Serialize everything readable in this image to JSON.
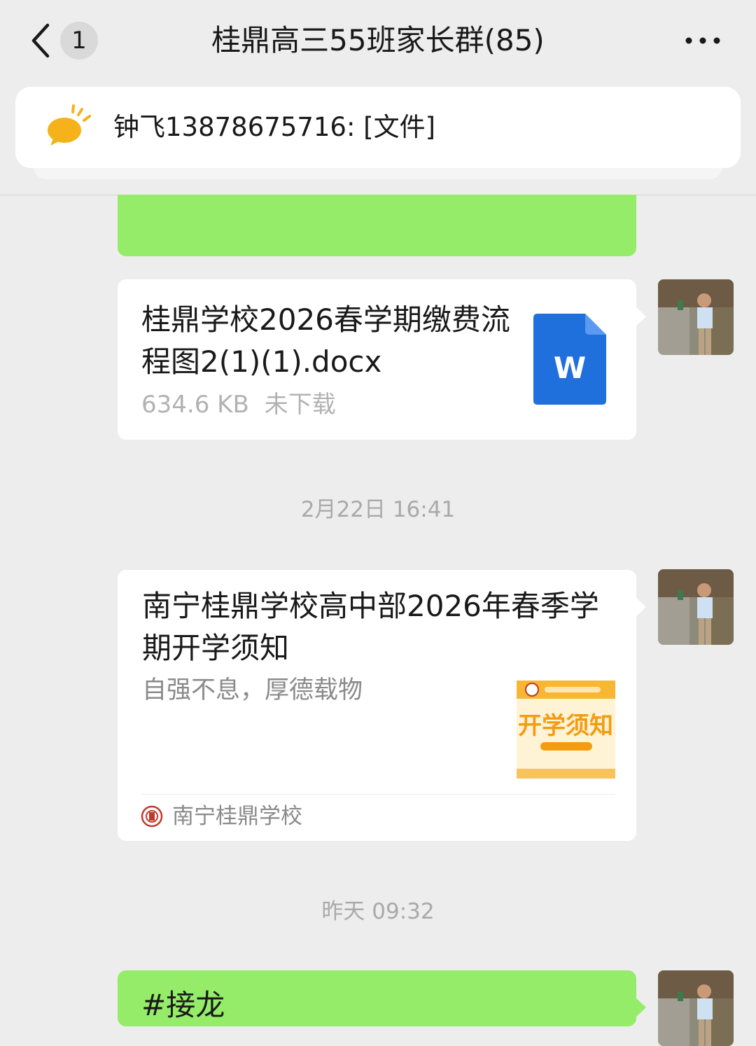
{
  "header": {
    "back_icon": "chevron-left-icon",
    "unread_count": "1",
    "title": "桂鼎高三55班家长群(85)",
    "more_icon": "ellipsis-icon"
  },
  "pinned": {
    "icon": "announcement-icon",
    "text": "钟飞13878675716: [文件]"
  },
  "messages": {
    "file": {
      "name": "桂鼎学校2026春学期缴费流程图2(1)(1).docx",
      "size": "634.6 KB",
      "status": "未下载",
      "icon_letter": "W"
    },
    "time1": "2月22日 16:41",
    "article": {
      "title": "南宁桂鼎学校高中部2026年春季学期开学须知",
      "description": "自强不息，厚德载物",
      "thumbnail_text": "开学须知",
      "source": "南宁桂鼎学校"
    },
    "time2": "昨天 09:32",
    "solitaire": {
      "text": "#接龙"
    }
  },
  "colors": {
    "background": "#ededed",
    "sent_bubble": "#95ec69",
    "word_blue": "#1f6fdc",
    "announce_yellow": "#f6b21b"
  }
}
